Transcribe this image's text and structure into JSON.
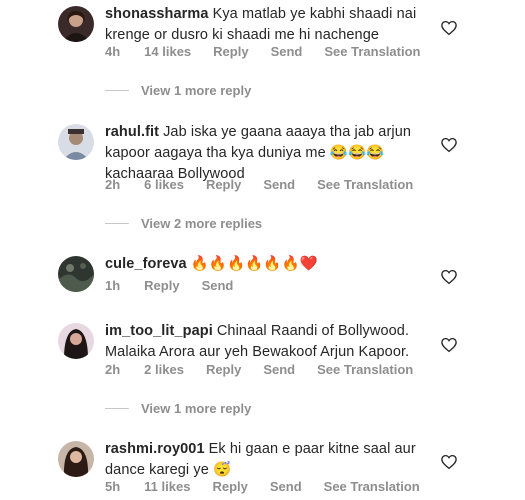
{
  "comments": [
    {
      "username": "shonassharma",
      "text": "Kya matlab ye kabhi shaadi nai krenge or dusro ki shaadi me hi nachenge",
      "time": "4h",
      "likes": "14 likes",
      "reply": "Reply",
      "send": "Send",
      "translation": "See Translation"
    },
    {
      "username": "rahul.fit",
      "text": "Jab iska ye gaana aaaya tha jab arjun kapoor aagaya tha kya duniya me 😂😂😂 kachaaraa Bollywood",
      "time": "2h",
      "likes": "6 likes",
      "reply": "Reply",
      "send": "Send",
      "translation": "See Translation"
    },
    {
      "username": "cule_foreva",
      "text": "🔥🔥🔥🔥🔥🔥❤️",
      "time": "1h",
      "reply": "Reply",
      "send": "Send"
    },
    {
      "username": "im_too_lit_papi",
      "text": "Chinaal Raandi of Bollywood. Malaika Arora aur yeh Bewakoof Arjun Kapoor.",
      "time": "2h",
      "likes": "2 likes",
      "reply": "Reply",
      "send": "Send",
      "translation": "See Translation"
    },
    {
      "username": "rashmi.roy001",
      "text": "Ek hi gaan e paar kitne saal aur dance karegi ye 😴",
      "time": "5h",
      "likes": "11 likes",
      "reply": "Reply",
      "send": "Send",
      "translation": "See Translation"
    }
  ],
  "view_more": [
    "View 1 more reply",
    "View 2 more replies",
    "View 1 more reply"
  ],
  "icons": {
    "like": "heart-outline-icon"
  },
  "colors": {
    "text": "#262626",
    "secondary": "#8e8e8e",
    "divider": "#c7c7c7"
  }
}
